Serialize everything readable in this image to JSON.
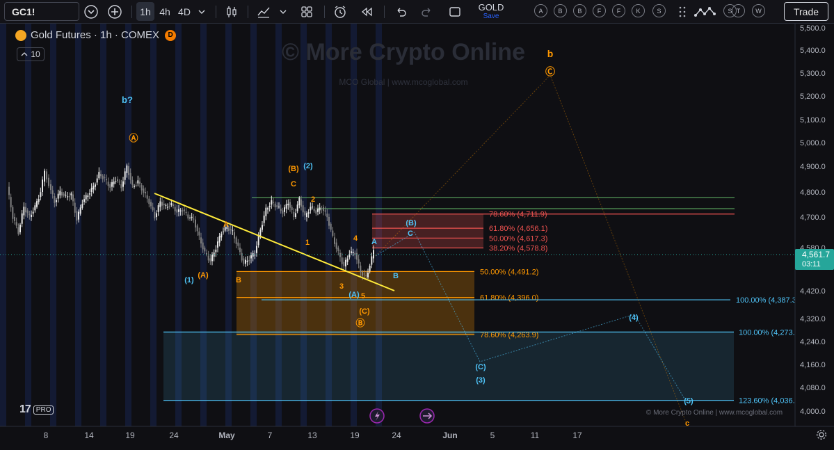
{
  "toolbar": {
    "symbol": "GC1!",
    "intervals": [
      "1h",
      "4h",
      "4D"
    ],
    "active_interval": "1h",
    "layout_name": "GOLD",
    "layout_save": "Save",
    "quick_letters": [
      "A",
      "B",
      "B",
      "F",
      "F",
      "K",
      "S",
      "T",
      "W"
    ],
    "trade_label": "Trade"
  },
  "legend": {
    "title": "Gold Futures · 1h · COMEX",
    "badge": "D",
    "sub_value": "10"
  },
  "watermark": {
    "main": "© More Crypto Online",
    "sub": "MCO Global | www.mcoglobal.com",
    "footer": "© More Crypto Online  |  www.mcoglobal.com"
  },
  "brand": {
    "mark": "17",
    "tier": "PRO"
  },
  "colors": {
    "background": "#0f0f13",
    "bull": "#e8e8e8",
    "bear": "#808080",
    "trendline": "#ffeb3b",
    "orange": "#ff9800",
    "cyan": "#4fc3f7",
    "fib_red": "#ef5350",
    "green_line": "#66bb6a",
    "price_badge": "#26a69a"
  },
  "chart_data": {
    "type": "candlestick",
    "instrument": "Gold Futures · 1h · COMEX",
    "y_axis": {
      "ticks": [
        "5,500.0",
        "5,400.0",
        "5,300.0",
        "5,200.0",
        "5,100.0",
        "5,000.0",
        "4,900.0",
        "4,800.0",
        "4,700.0",
        "4,580.0",
        "4,420.0",
        "4,320.0",
        "4,240.0",
        "4,160.0",
        "4,080.0",
        "4,000.0"
      ],
      "tick_values": [
        5500,
        5400,
        5300,
        5200,
        5100,
        5000,
        4900,
        4800,
        4700,
        4580,
        4420,
        4320,
        4240,
        4160,
        4080,
        4000
      ]
    },
    "x_axis": {
      "labels": [
        "8",
        "14",
        "19",
        "24",
        "May",
        "7",
        "13",
        "19",
        "24",
        "Jun",
        "5",
        "11",
        "17"
      ]
    },
    "current_price": {
      "value": 4561.7,
      "label": "4,561.7",
      "countdown": "03:11"
    },
    "fib_levels": [
      {
        "label": "78.60% (4,711.9)",
        "value": 4711.9,
        "color": "#ef5350"
      },
      {
        "label": "61.80% (4,656.1)",
        "value": 4656.1,
        "color": "#ef5350"
      },
      {
        "label": "50.00% (4,617.3)",
        "value": 4617.3,
        "color": "#ef5350"
      },
      {
        "label": "38.20% (4,578.8)",
        "value": 4578.8,
        "color": "#ef5350"
      },
      {
        "label": "50.00% (4,491.2)",
        "value": 4491.2,
        "color": "#ff9800"
      },
      {
        "label": "61.80% (4,396.0)",
        "value": 4396.0,
        "color": "#ff9800"
      },
      {
        "label": "78.60% (4,263.9)",
        "value": 4263.9,
        "color": "#ff9800"
      },
      {
        "label": "100.00% (4,387.3)",
        "value": 4387.3,
        "color": "#4fc3f7"
      },
      {
        "label": "100.00% (4,273.",
        "value": 4273,
        "color": "#4fc3f7"
      },
      {
        "label": "123.60% (4,036.",
        "value": 4036,
        "color": "#4fc3f7"
      }
    ],
    "wave_labels": [
      {
        "text": "b?",
        "color": "#4fc3f7"
      },
      {
        "text": "Ⓐ",
        "color": "#ff9800"
      },
      {
        "text": "(1)",
        "color": "#4fc3f7"
      },
      {
        "text": "(A)",
        "color": "#ff9800"
      },
      {
        "text": "A",
        "color": "#ff9800"
      },
      {
        "text": "B",
        "color": "#ff9800"
      },
      {
        "text": "(B)",
        "color": "#ff9800"
      },
      {
        "text": "(2)",
        "color": "#4fc3f7"
      },
      {
        "text": "C",
        "color": "#ff9800"
      },
      {
        "text": "2",
        "color": "#ff9800"
      },
      {
        "text": "1",
        "color": "#ff9800"
      },
      {
        "text": "3",
        "color": "#ff9800"
      },
      {
        "text": "4",
        "color": "#ff9800"
      },
      {
        "text": "5",
        "color": "#ff9800"
      },
      {
        "text": "(A)",
        "color": "#4fc3f7"
      },
      {
        "text": "(C)",
        "color": "#ff9800"
      },
      {
        "text": "Ⓑ",
        "color": "#ff9800"
      },
      {
        "text": "A",
        "color": "#4fc3f7"
      },
      {
        "text": "B",
        "color": "#4fc3f7"
      },
      {
        "text": "(B)",
        "color": "#4fc3f7"
      },
      {
        "text": "C",
        "color": "#4fc3f7"
      },
      {
        "text": "(4)",
        "color": "#4fc3f7"
      },
      {
        "text": "(C)",
        "color": "#4fc3f7"
      },
      {
        "text": "(3)",
        "color": "#4fc3f7"
      },
      {
        "text": "(5)",
        "color": "#4fc3f7"
      },
      {
        "text": "b",
        "color": "#ff9800"
      },
      {
        "text": "Ⓒ",
        "color": "#ff9800"
      },
      {
        "text": "c",
        "color": "#ff9800"
      }
    ],
    "grid": false,
    "legend_position": "top-left"
  }
}
